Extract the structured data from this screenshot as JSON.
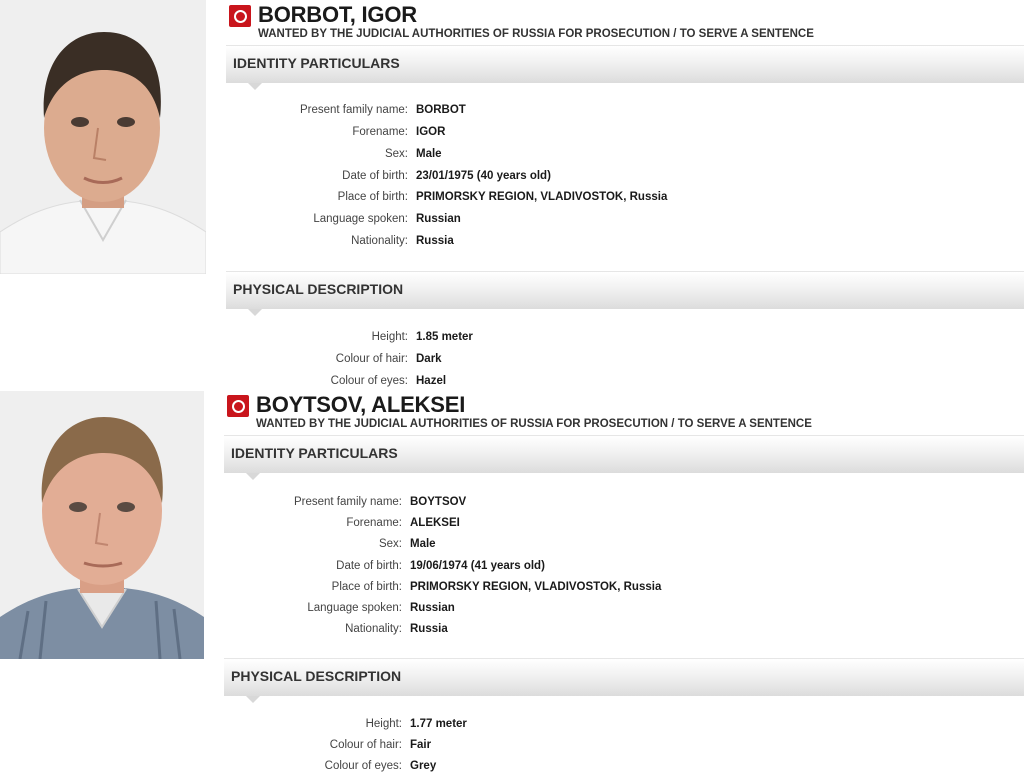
{
  "notices": [
    {
      "name": "BORBOT, IGOR",
      "subtitle": "WANTED BY THE JUDICIAL AUTHORITIES OF RUSSIA FOR PROSECUTION / TO SERVE A SENTENCE",
      "identity_title": "IDENTITY PARTICULARS",
      "identity": [
        {
          "label": "Present family name:",
          "value": "BORBOT"
        },
        {
          "label": "Forename:",
          "value": "IGOR"
        },
        {
          "label": "Sex:",
          "value": "Male"
        },
        {
          "label": "Date of birth:",
          "value": "23/01/1975 (40 years old)"
        },
        {
          "label": "Place of birth:",
          "value": "PRIMORSKY REGION, VLADIVOSTOK, Russia"
        },
        {
          "label": "Language spoken:",
          "value": "Russian"
        },
        {
          "label": "Nationality:",
          "value": "Russia"
        }
      ],
      "physical_title": "PHYSICAL DESCRIPTION",
      "physical": [
        {
          "label": "Height:",
          "value": "1.85 meter"
        },
        {
          "label": "Colour of hair:",
          "value": "Dark"
        },
        {
          "label": "Colour of eyes:",
          "value": "Hazel"
        }
      ],
      "colors": {
        "shirt": "#f4f4f4",
        "hair": "#3a2e25",
        "skin": "#d9a88c"
      }
    },
    {
      "name": "BOYTSOV, ALEKSEI",
      "subtitle": "WANTED BY THE JUDICIAL AUTHORITIES OF RUSSIA FOR PROSECUTION / TO SERVE A SENTENCE",
      "identity_title": "IDENTITY PARTICULARS",
      "identity": [
        {
          "label": "Present family name:",
          "value": "BOYTSOV"
        },
        {
          "label": "Forename:",
          "value": "ALEKSEI"
        },
        {
          "label": "Sex:",
          "value": "Male"
        },
        {
          "label": "Date of birth:",
          "value": "19/06/1974 (41 years old)"
        },
        {
          "label": "Place of birth:",
          "value": "PRIMORSKY REGION, VLADIVOSTOK, Russia"
        },
        {
          "label": "Language spoken:",
          "value": "Russian"
        },
        {
          "label": "Nationality:",
          "value": "Russia"
        }
      ],
      "physical_title": "PHYSICAL DESCRIPTION",
      "physical": [
        {
          "label": "Height:",
          "value": "1.77 meter"
        },
        {
          "label": "Colour of hair:",
          "value": "Fair"
        },
        {
          "label": "Colour of eyes:",
          "value": "Grey"
        }
      ],
      "colors": {
        "shirt": "#7d8ea3",
        "hair": "#8a6a4a",
        "skin": "#e2ad95"
      }
    }
  ],
  "theme": {
    "logo_red": "#c9151c",
    "section_bg": "#ececec"
  }
}
